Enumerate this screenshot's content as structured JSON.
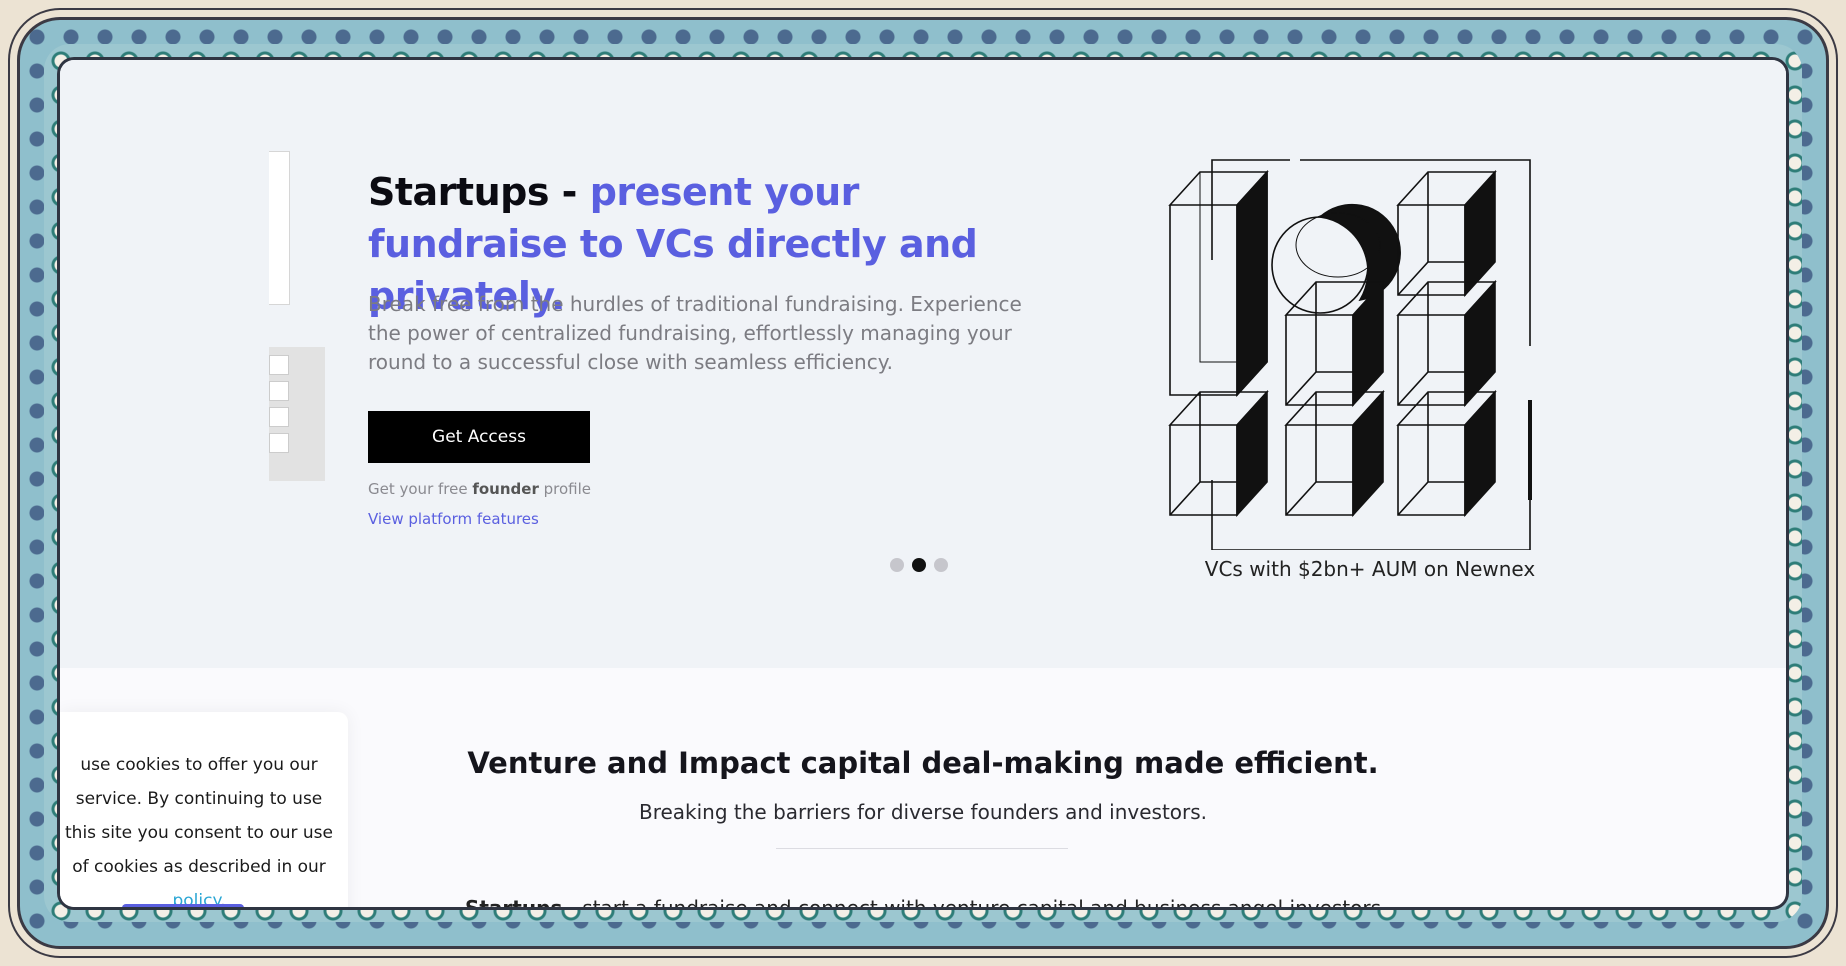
{
  "hero": {
    "title_part1": "Startups - ",
    "title_accent": "present your fundraise to VCs directly and privately.",
    "description": "Break free from the hurdles of traditional fundraising. Experience the power of centralized fundraising, effortlessly managing your round to a successful close with seamless efficiency.",
    "cta_label": "Get Access",
    "free_prefix": "Get your free ",
    "free_bold": "founder",
    "free_suffix": " profile",
    "features_link": "View platform features",
    "carousel_active_index": 1,
    "carousel_count": 3,
    "vc_caption": "VCs with $2bn+ AUM on Newnex"
  },
  "section": {
    "title": "Venture and Impact capital deal-making made efficient.",
    "subtitle": "Breaking the barriers for diverse founders and investors.",
    "partial_line_bold": "Startups",
    "partial_line_rest": " - start a fundraise and connect with venture capital and business angel investors"
  },
  "cookie": {
    "text_before_link": "use cookies to offer you our service. By continuing to use this site you consent to our use of cookies as described in our ",
    "link_label": "policy",
    "text_after_link": "."
  },
  "colors": {
    "accent": "#5a5fe0",
    "hero_bg": "#f0f3f7",
    "button_bg": "#000000",
    "link_blue": "#2aa6d4"
  },
  "icons": [
    "cube-grid-illustration"
  ]
}
